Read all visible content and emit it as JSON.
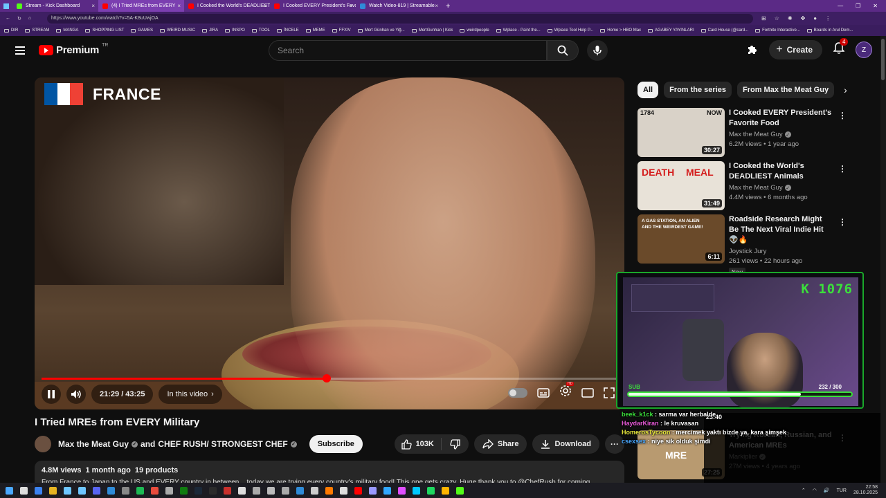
{
  "browser": {
    "tabs": [
      {
        "title": "Stream - Kick Dashboard",
        "fav": "#53fc18"
      },
      {
        "title": "(4) I Tried MREs from EVERY",
        "fav": "#ff0000"
      },
      {
        "title": "I Cooked the World's DEADLIEST",
        "fav": "#ff0000"
      },
      {
        "title": "I Cooked EVERY President's Favo",
        "fav": "#ff0000"
      },
      {
        "title": "Watch Video-819 | Streamable",
        "fav": "#2f8bd8"
      }
    ],
    "new_tab": "+",
    "url": "https://www.youtube.com/watch?v=5A-K8uUwjOA",
    "bookmarks": [
      "DIR",
      "STREAM",
      "MANGA",
      "SHOPPING LIST",
      "GAMES",
      "WEIRD MUSIC",
      "JIRA",
      "INSPO",
      "TOOL",
      "İNCELE",
      "MEME",
      "FFXIV",
      "Mert Günhan ve Yiğ...",
      "MertGunhan | Kick",
      "weirdpeople",
      "Wplace - Paint the...",
      "Wplace Tool Help P...",
      "Home > HBO Max",
      "AGABEY YAYINLARI",
      "Card House (@card...",
      "Fortnite Interactive...",
      "Boards in Arul Dem..."
    ]
  },
  "header": {
    "logo_text": "Premium",
    "region": "TR",
    "search_placeholder": "Search",
    "create_label": "Create",
    "notifications": "4",
    "avatar_letter": "Z"
  },
  "player": {
    "overlay_country": "FRANCE",
    "time_current": "21:29",
    "time_total": "43:25",
    "time_label": "21:29 / 43:25",
    "chapter_label": "In this video",
    "progress": 0.495,
    "hd_badge": "HD"
  },
  "video": {
    "title": "I Tried MREs from EVERY Military",
    "channel": "Max the Meat Guy",
    "collab_sep": "and",
    "collab": "CHEF RUSH/ STRONGEST CHEF",
    "subscribe": "Subscribe",
    "likes": "103K",
    "share": "Share",
    "download": "Download",
    "views": "4.8M views",
    "age": "1 month ago",
    "products": "19 products",
    "description": "From France to Japan to the US and EVERY country in between... today we are trying every country's military food! This one gets crazy. Huge thank you to @ChefRush for coming"
  },
  "chips": [
    "All",
    "From the series",
    "From Max the Meat Guy"
  ],
  "recommendations": [
    {
      "title": "I Cooked EVERY President's Favorite Food",
      "channel": "Max the Meat Guy",
      "verified": true,
      "stats": "6.2M views • 1 year ago",
      "duration": "30:27",
      "thumb_bg": "#d9d2c8",
      "thumb_text": "1784",
      "thumb_text2": "NOW",
      "new": false
    },
    {
      "title": "I Cooked the World's DEADLIEST Animals",
      "channel": "Max the Meat Guy",
      "verified": true,
      "stats": "4.4M views • 6 months ago",
      "duration": "31:49",
      "thumb_bg": "#e8e2d8",
      "thumb_text": "DEATH",
      "thumb_text2": "MEAL",
      "new": false
    },
    {
      "title": "Roadside Research Might Be The Next Viral Indie Hit 👽🔥",
      "channel": "Joystick Jury",
      "verified": false,
      "stats": "261 views • 22 hours ago",
      "duration": "6:11",
      "thumb_bg": "#6a4a2a",
      "thumb_text": "A GAS STATION, AN ALIEN",
      "thumb_text2": "AND THE WEIRDEST GAME!",
      "new": true,
      "new_label": "New"
    },
    {
      "title": "Trying Korean, Russian, and American MREs",
      "channel": "Markiplier",
      "verified": true,
      "stats": "27M views • 4 years ago",
      "duration": "27:25",
      "thumb_bg": "#b89a70",
      "thumb_text": "MRE",
      "thumb_text2": "",
      "new": false
    }
  ],
  "hidden_duration": "23:40",
  "stream_overlay": {
    "kick_count": "K 1076",
    "sub_label": "SUB",
    "sub_current": "232",
    "sub_goal": "300",
    "sub_text": "232 / 300",
    "sub_progress": 0.773,
    "chat": [
      {
        "user": "beek_k1ck",
        "color": "#3be03b",
        "msg": "sarma var herbalde"
      },
      {
        "user": "HaydarKiran",
        "color": "#e85ad8",
        "msg": "le kruvasan"
      },
      {
        "user": "HomerosTycoon",
        "color": "#e8e83b",
        "msg": "mercimek yaktı bizde ya, kara şimşek"
      },
      {
        "user": "csexsex",
        "color": "#4aa8ff",
        "msg": "niye sik olduk şimdi"
      }
    ]
  },
  "taskbar": {
    "lang": "TUR",
    "time": "22:58",
    "date": "28.10.2025"
  },
  "colors": {
    "accent_red": "#ff0000",
    "kick_green": "#53fc18",
    "browser_purple": "#5b2a86"
  }
}
